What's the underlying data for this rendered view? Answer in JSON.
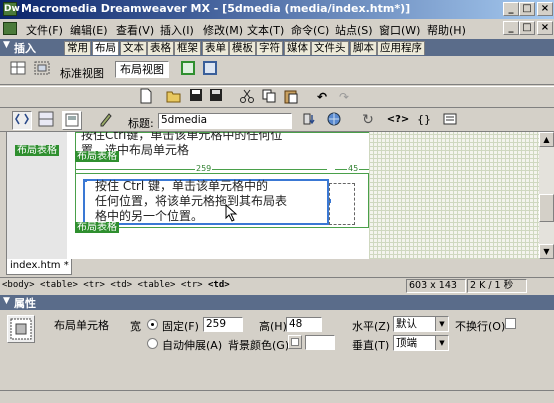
{
  "window": {
    "title": "Macromedia Dreamweaver MX - [5dmedia (media/index.htm*)]",
    "controls": [
      "_",
      "□",
      "×"
    ],
    "doc_controls": [
      "_",
      "□",
      "×"
    ],
    "app_icon": "Dw"
  },
  "menu": [
    "文件(F)",
    "编辑(E)",
    "查看(V)",
    "插入(I)",
    "修改(M)",
    "文本(T)",
    "命令(C)",
    "站点(S)",
    "窗口(W)",
    "帮助(H)"
  ],
  "insert_panel": {
    "title": "插入",
    "tabs": [
      "常用",
      "布局",
      "文本",
      "表格",
      "框架",
      "表单",
      "模板",
      "字符",
      "媒体",
      "文件头",
      "脚本",
      "应用程序"
    ],
    "active_tab": "布局",
    "view_label": "标准视图",
    "view_button": "布局视图"
  },
  "document_toolbar": {
    "title_label": "标题:",
    "title_value": "5dmedia"
  },
  "design": {
    "layout_table_label": "布局表格",
    "top_text_line1": "按住Ctrl键，单击该单元格中的任何位",
    "top_text_line2": "置，选中布局单元格",
    "width_left": "259",
    "width_right": "45",
    "cell_text_line1": "按住 Ctrl 键，单击该单元格中的",
    "cell_text_line2": "任何位置，将该单元格拖到其布局表",
    "cell_text_line3": "格中的另一个位置。"
  },
  "doc_tab": "index.htm *",
  "status": {
    "tag_selector": [
      "<body>",
      "<table>",
      "<tr>",
      "<td>",
      "<table>",
      "<tr>",
      "<td>"
    ],
    "size": "603 x 143",
    "download": "2 K / 1 秒"
  },
  "properties": {
    "title": "属性",
    "element_name": "布局单元格",
    "width_label": "宽",
    "fixed_label": "固定(F)",
    "width_value": "259",
    "height_label": "高(H)",
    "height_value": "48",
    "autostretch_label": "自动伸展(A)",
    "bgcolor_label": "背景颜色(G)",
    "halign_label": "水平(Z)",
    "halign_value": "默认",
    "nowrap_label": "不换行(O)",
    "valign_label": "垂直(T)",
    "valign_value": "顶端"
  }
}
